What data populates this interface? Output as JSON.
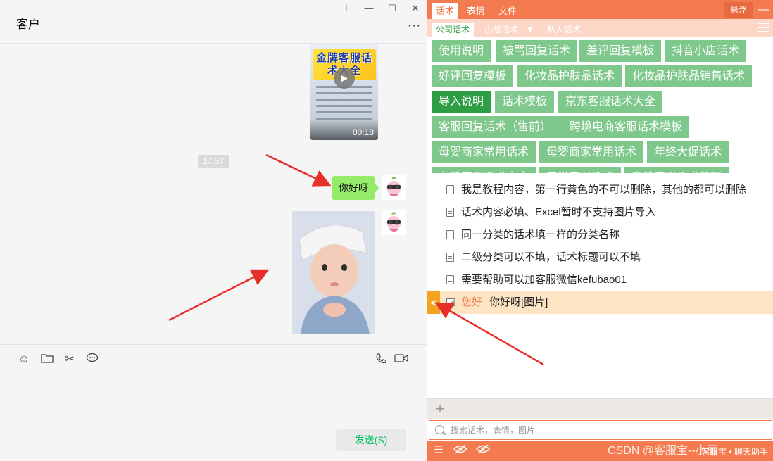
{
  "chat": {
    "title": "客户",
    "window_buttons": {
      "pin": "⊥",
      "minimize": "—",
      "maximize": "☐",
      "close": "✕"
    },
    "more": "···",
    "video": {
      "banner_text": "金牌客服话术大全",
      "duration": "00:18"
    },
    "timestamp": "17:57",
    "message_text": "你好呀",
    "send_label": "发送(S)"
  },
  "panel": {
    "tabs": [
      {
        "label": "话术",
        "active": true
      },
      {
        "label": "表情",
        "active": false
      },
      {
        "label": "文件",
        "active": false
      }
    ],
    "float_label": "悬浮",
    "subtabs": [
      {
        "label": "公司话术",
        "active": true
      },
      {
        "label": "小组话术",
        "active": false
      },
      {
        "label": "▼",
        "active": false
      },
      {
        "label": "私人话术",
        "active": false
      }
    ],
    "tags": [
      {
        "label": "使用说明"
      },
      {
        "label": "被骂回复话术"
      },
      {
        "label": "差评回复模板"
      },
      {
        "label": "抖音小店话术"
      },
      {
        "label": "好评回复模板"
      },
      {
        "label": "化妆品护肤品话术"
      },
      {
        "label": "化妆品护肤品销售话术"
      },
      {
        "label": "导入说明"
      },
      {
        "label": "话术模板"
      },
      {
        "label": "京东客服话术大全"
      },
      {
        "label": "客服回复话术（售前）"
      },
      {
        "label": "跨境电商客服话术模板"
      },
      {
        "label": "母婴商家常用话术"
      },
      {
        "label": "母婴商家常用话术"
      },
      {
        "label": "年终大促话术"
      },
      {
        "label": "女装客服话术大全"
      },
      {
        "label": "天猫客服话术"
      },
      {
        "label": "童装客服话术整理"
      }
    ],
    "list": [
      {
        "text": "我是教程内容，第一行黄色的不可以删除，其他的都可以删除"
      },
      {
        "text": "话术内容必填、Excel暂时不支持图片导入"
      },
      {
        "text": "同一分类的话术填一样的分类名称"
      },
      {
        "text": "二级分类可以不填，话术标题可以不填"
      },
      {
        "text": "需要帮助可以加客服微信kefubao01"
      }
    ],
    "highlight": {
      "marker": "<",
      "greeting": "您好",
      "text": "你好呀[图片]"
    },
    "add": "+",
    "search_placeholder": "搜索话术，表情，图片",
    "bottom_right": "客服宝 • 聊天助手"
  },
  "watermark": "CSDN @客服宝--小丽"
}
